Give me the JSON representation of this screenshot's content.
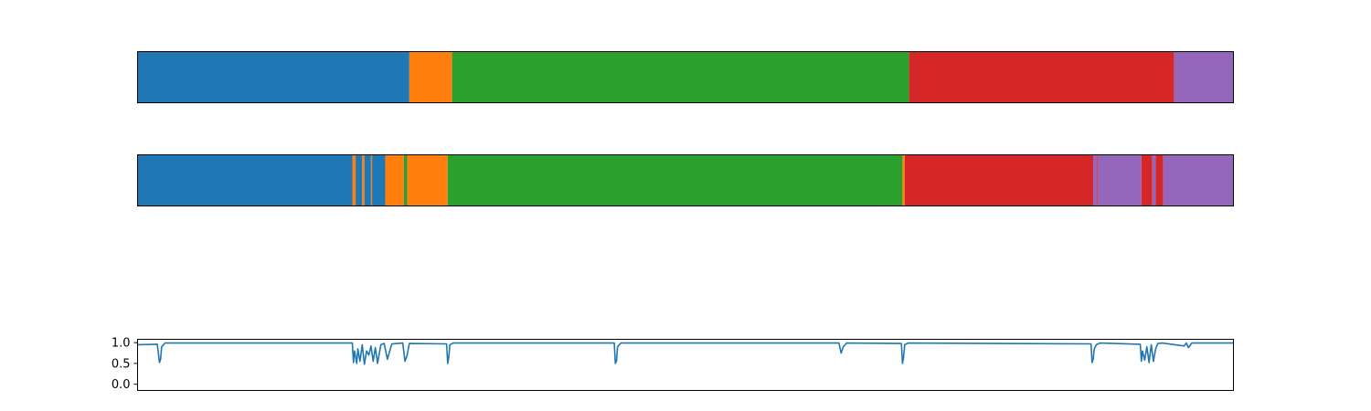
{
  "colors": {
    "blue": "#1f77b4",
    "orange": "#ff7f0e",
    "green": "#2ca02c",
    "red": "#d62728",
    "purple": "#9467bd"
  },
  "chart_data": [
    {
      "type": "bar",
      "orientation": "segmented-strip",
      "title": "",
      "xlabel": "",
      "ylabel": "",
      "xlim": [
        0,
        1
      ],
      "segments": [
        {
          "start": 0.0,
          "end": 0.248,
          "color": "blue"
        },
        {
          "start": 0.248,
          "end": 0.287,
          "color": "orange"
        },
        {
          "start": 0.287,
          "end": 0.704,
          "color": "green"
        },
        {
          "start": 0.704,
          "end": 0.946,
          "color": "red"
        },
        {
          "start": 0.946,
          "end": 1.0,
          "color": "purple"
        }
      ]
    },
    {
      "type": "bar",
      "orientation": "segmented-strip",
      "title": "",
      "xlabel": "",
      "ylabel": "",
      "xlim": [
        0,
        1
      ],
      "segments": [
        {
          "start": 0.0,
          "end": 0.196,
          "color": "blue"
        },
        {
          "start": 0.196,
          "end": 0.199,
          "color": "orange"
        },
        {
          "start": 0.199,
          "end": 0.205,
          "color": "blue"
        },
        {
          "start": 0.205,
          "end": 0.207,
          "color": "orange"
        },
        {
          "start": 0.207,
          "end": 0.213,
          "color": "blue"
        },
        {
          "start": 0.213,
          "end": 0.214,
          "color": "orange"
        },
        {
          "start": 0.214,
          "end": 0.226,
          "color": "blue"
        },
        {
          "start": 0.226,
          "end": 0.243,
          "color": "orange"
        },
        {
          "start": 0.243,
          "end": 0.246,
          "color": "green"
        },
        {
          "start": 0.246,
          "end": 0.283,
          "color": "orange"
        },
        {
          "start": 0.283,
          "end": 0.698,
          "color": "green"
        },
        {
          "start": 0.698,
          "end": 0.7,
          "color": "orange"
        },
        {
          "start": 0.7,
          "end": 0.872,
          "color": "red"
        },
        {
          "start": 0.872,
          "end": 0.875,
          "color": "purple"
        },
        {
          "start": 0.875,
          "end": 0.876,
          "color": "red"
        },
        {
          "start": 0.876,
          "end": 0.916,
          "color": "purple"
        },
        {
          "start": 0.916,
          "end": 0.926,
          "color": "red"
        },
        {
          "start": 0.926,
          "end": 0.929,
          "color": "purple"
        },
        {
          "start": 0.929,
          "end": 0.936,
          "color": "red"
        },
        {
          "start": 0.936,
          "end": 1.0,
          "color": "purple"
        }
      ]
    },
    {
      "type": "line",
      "title": "",
      "xlabel": "",
      "ylabel": "",
      "xlim": [
        0,
        1
      ],
      "ylim": [
        -0.15,
        1.08
      ],
      "yticks": [
        "1.0",
        "0.5",
        "0.0"
      ],
      "ytick_values": [
        1.0,
        0.5,
        0.0
      ],
      "series": [
        {
          "color": "blue",
          "baseline": 0.99,
          "x": [
            0.0,
            0.018,
            0.02,
            0.021,
            0.022,
            0.025,
            0.196,
            0.197,
            0.198,
            0.2,
            0.201,
            0.203,
            0.205,
            0.207,
            0.209,
            0.211,
            0.213,
            0.215,
            0.217,
            0.219,
            0.222,
            0.225,
            0.228,
            0.232,
            0.237,
            0.242,
            0.244,
            0.246,
            0.248,
            0.282,
            0.283,
            0.284,
            0.285,
            0.288,
            0.435,
            0.436,
            0.437,
            0.438,
            0.441,
            0.64,
            0.642,
            0.644,
            0.647,
            0.697,
            0.698,
            0.699,
            0.7,
            0.703,
            0.87,
            0.871,
            0.872,
            0.873,
            0.875,
            0.878,
            0.915,
            0.916,
            0.917,
            0.919,
            0.921,
            0.923,
            0.925,
            0.927,
            0.929,
            0.931,
            0.935,
            0.955,
            0.957,
            0.959,
            0.962,
            1.0
          ],
          "y": [
            0.95,
            0.96,
            0.52,
            0.6,
            0.9,
            0.99,
            0.99,
            0.52,
            0.8,
            0.5,
            0.85,
            0.55,
            0.95,
            0.48,
            0.8,
            0.7,
            0.92,
            0.55,
            0.88,
            0.5,
            0.95,
            0.98,
            0.6,
            0.97,
            0.98,
            0.99,
            0.55,
            0.7,
            0.98,
            0.97,
            0.5,
            0.65,
            0.95,
            0.99,
            0.99,
            0.5,
            0.55,
            0.9,
            0.99,
            0.99,
            0.75,
            0.9,
            0.99,
            0.98,
            0.5,
            0.65,
            0.95,
            0.99,
            0.97,
            0.52,
            0.6,
            0.85,
            0.95,
            0.99,
            0.96,
            0.55,
            0.8,
            0.58,
            0.9,
            0.52,
            0.95,
            0.55,
            0.85,
            0.98,
            0.99,
            0.92,
            0.99,
            0.88,
            0.99,
            0.99
          ]
        }
      ]
    }
  ]
}
